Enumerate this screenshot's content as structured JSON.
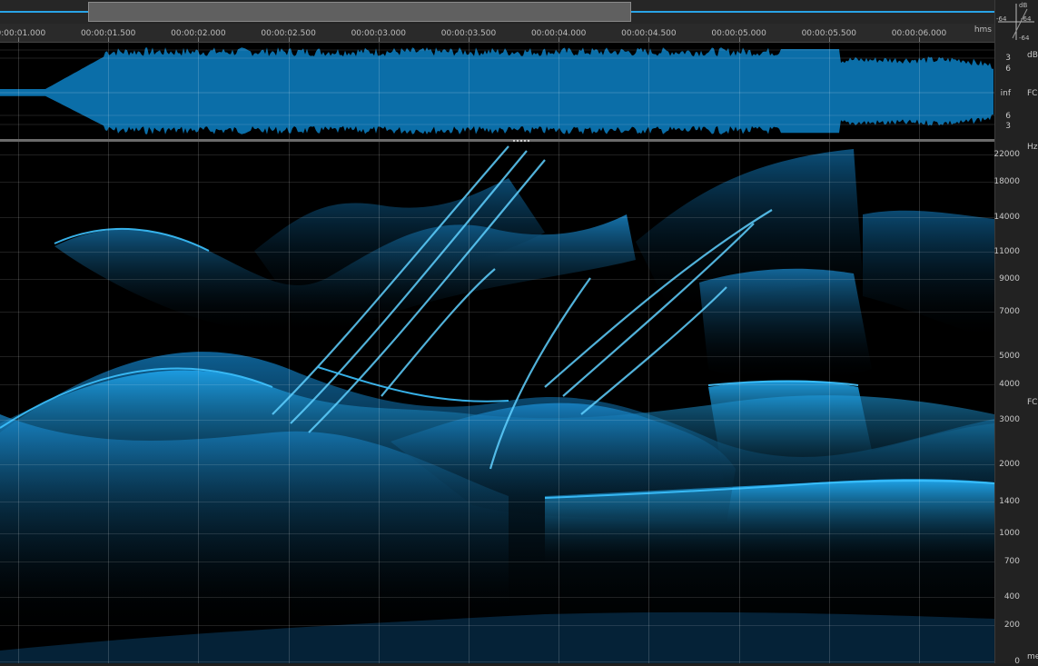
{
  "ruler": {
    "unit": "hms",
    "labels": [
      "00:00:01.000",
      "00:00:01.500",
      "00:00:02.000",
      "00:00:02.500",
      "00:00:03.000",
      "00:00:03.500",
      "00:00:04.000",
      "00:00:04.500",
      "00:00:05.000",
      "00:00:05.500",
      "00:00:06.000"
    ]
  },
  "waveform_axis": {
    "unit": "dB",
    "labels": [
      "3",
      "6",
      "inf",
      "6",
      "3"
    ]
  },
  "spectral_axis": {
    "unit": "Hz",
    "labels": [
      "22000",
      "18000",
      "14000",
      "11000",
      "9000",
      "7000",
      "5000",
      "4000",
      "3000",
      "2000",
      "1400",
      "1000",
      "700",
      "400",
      "200",
      "0"
    ],
    "values": [
      22000,
      18000,
      14000,
      11000,
      9000,
      7000,
      5000,
      4000,
      3000,
      2000,
      1400,
      1000,
      700,
      400,
      200,
      0
    ]
  },
  "corner": {
    "top": "dB",
    "left": "-64",
    "right": "-64",
    "bottom": "-64"
  },
  "side_labels": {
    "waveform": "FC",
    "spectral": "FC",
    "bottom": "me"
  },
  "colors": {
    "accent": "#29a3e6",
    "waveform": "#0b6ea8",
    "spectrogram": "#1a9ee8",
    "background": "#000000"
  }
}
